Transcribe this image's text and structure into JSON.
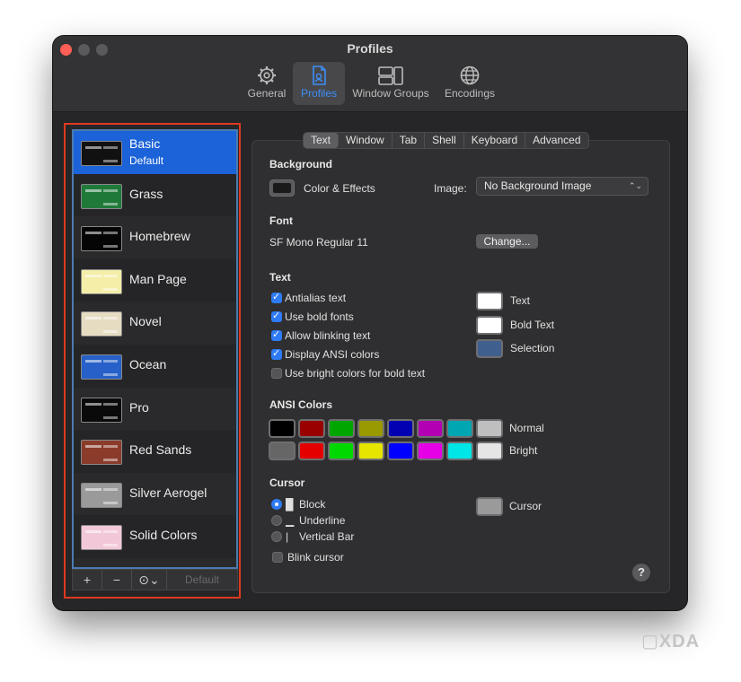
{
  "window": {
    "title": "Profiles"
  },
  "toolbar": [
    {
      "label": "General",
      "icon": "gear-icon"
    },
    {
      "label": "Profiles",
      "icon": "profiles-document-icon",
      "active": true
    },
    {
      "label": "Window Groups",
      "icon": "window-groups-icon"
    },
    {
      "label": "Encodings",
      "icon": "globe-icon"
    }
  ],
  "profiles": {
    "items": [
      {
        "name": "Basic",
        "sub": "Default",
        "selected": true,
        "thumb_bg": "#111111",
        "thumb_fg": "#ffffff"
      },
      {
        "name": "Grass",
        "thumb_bg": "#1f7a3a",
        "thumb_fg": "#f5e9a8"
      },
      {
        "name": "Homebrew",
        "thumb_bg": "#050505",
        "thumb_fg": "#22d22a"
      },
      {
        "name": "Man Page",
        "thumb_bg": "#f4eea8",
        "thumb_fg": "#111111"
      },
      {
        "name": "Novel",
        "thumb_bg": "#e6dcc2",
        "thumb_fg": "#5a3a20"
      },
      {
        "name": "Ocean",
        "thumb_bg": "#2660c8",
        "thumb_fg": "#ffffff"
      },
      {
        "name": "Pro",
        "thumb_bg": "#0a0a0a",
        "thumb_fg": "#d0d0d0"
      },
      {
        "name": "Red Sands",
        "thumb_bg": "#8a3b2a",
        "thumb_fg": "#e9d6b0"
      },
      {
        "name": "Silver Aerogel",
        "thumb_bg": "#9a9a9a",
        "thumb_fg": "#222222"
      },
      {
        "name": "Solid Colors",
        "thumb_bg": "#f2c8d8",
        "thumb_fg": "#333333"
      }
    ],
    "add_label": "+",
    "remove_label": "−",
    "more_label": "⊙⌄",
    "default_label": "Default"
  },
  "tabs": [
    "Text",
    "Window",
    "Tab",
    "Shell",
    "Keyboard",
    "Advanced"
  ],
  "background": {
    "heading": "Background",
    "color_effects_label": "Color & Effects",
    "image_label": "Image:",
    "image_value": "No Background Image",
    "well_color": "#1a1a1a"
  },
  "font": {
    "heading": "Font",
    "value": "SF Mono Regular 11",
    "change_label": "Change..."
  },
  "text": {
    "heading": "Text",
    "options": [
      {
        "label": "Antialias text",
        "checked": true
      },
      {
        "label": "Use bold fonts",
        "checked": true
      },
      {
        "label": "Allow blinking text",
        "checked": true
      },
      {
        "label": "Display ANSI colors",
        "checked": true
      },
      {
        "label": "Use bright colors for bold text",
        "checked": false
      }
    ],
    "colors": [
      {
        "label": "Text",
        "color": "#ffffff"
      },
      {
        "label": "Bold Text",
        "color": "#ffffff"
      },
      {
        "label": "Selection",
        "color": "#3f5f8f"
      }
    ]
  },
  "ansi": {
    "heading": "ANSI Colors",
    "normal_label": "Normal",
    "bright_label": "Bright",
    "normal": [
      "#000000",
      "#990000",
      "#00a600",
      "#999900",
      "#0000b2",
      "#b200b2",
      "#00a6b2",
      "#bfbfbf"
    ],
    "bright": [
      "#666666",
      "#e50000",
      "#00d900",
      "#e5e500",
      "#0000ff",
      "#e500e5",
      "#00e5e5",
      "#e5e5e5"
    ]
  },
  "cursor": {
    "heading": "Cursor",
    "options": [
      {
        "label": "Block",
        "glyph": "█",
        "selected": true
      },
      {
        "label": "Underline",
        "glyph": "▁",
        "selected": false
      },
      {
        "label": "Vertical Bar",
        "glyph": "|",
        "selected": false
      }
    ],
    "blink_label": "Blink cursor",
    "blink_checked": false,
    "color_label": "Cursor",
    "color": "#9a9a9a"
  },
  "help_label": "?",
  "watermark": "▢XDA"
}
